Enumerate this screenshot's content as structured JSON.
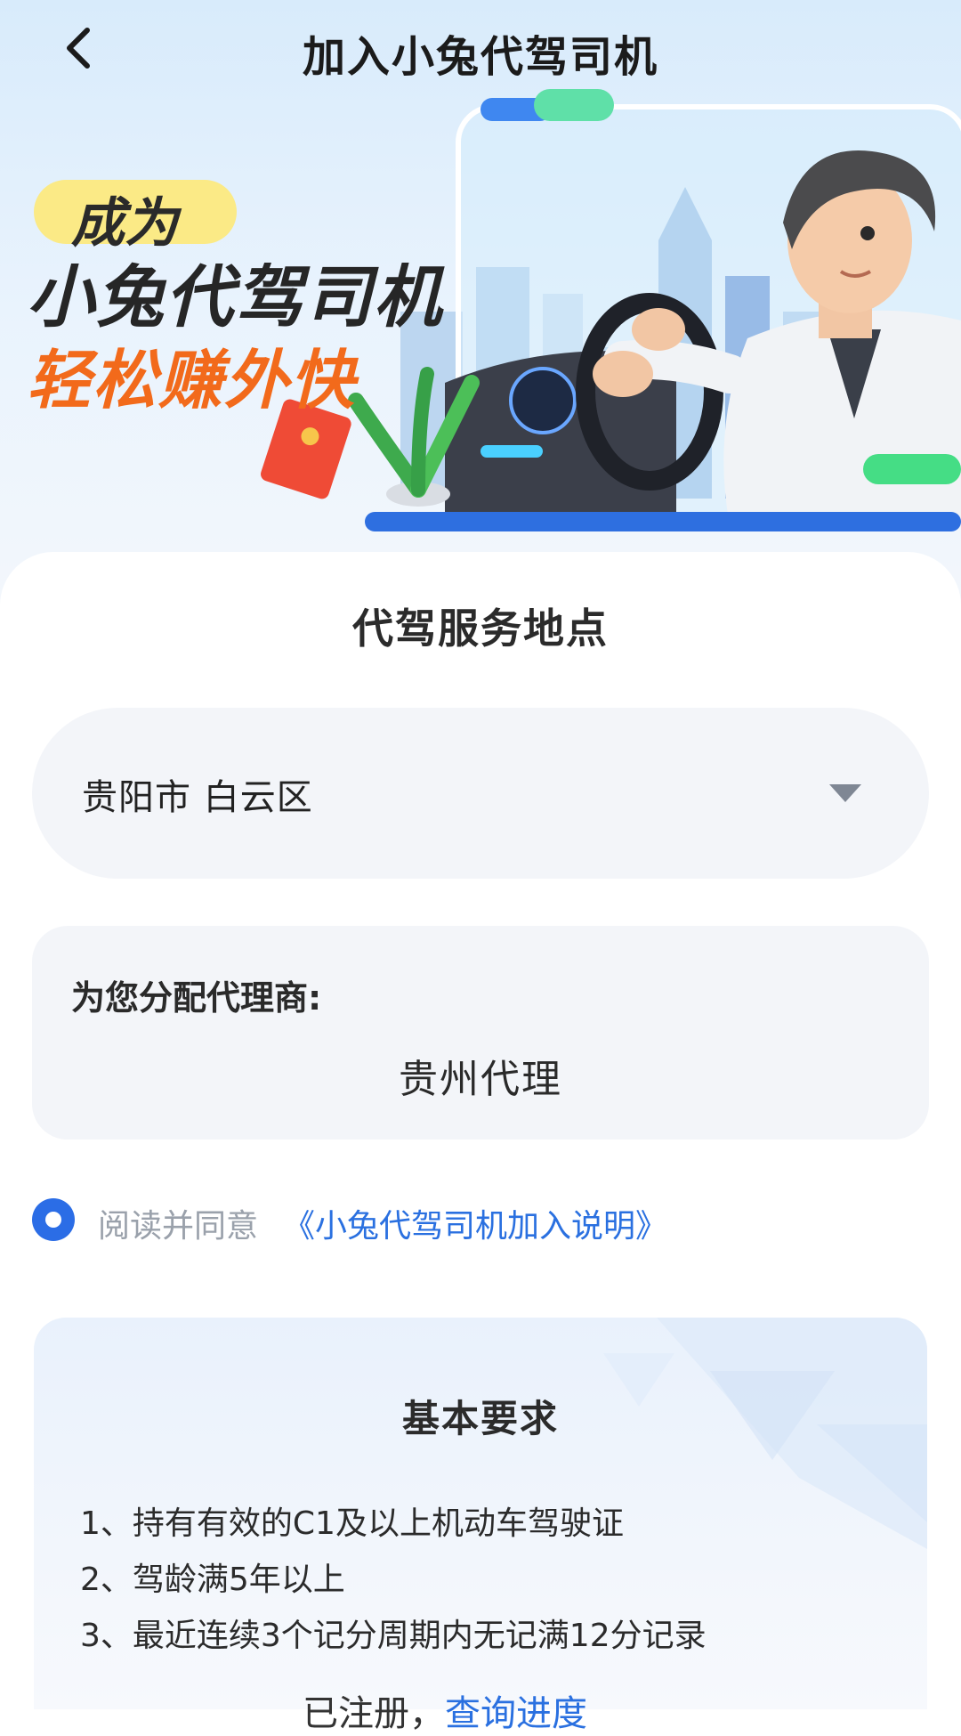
{
  "header": {
    "title": "加入小兔代驾司机",
    "back_icon": "chevron-left-icon"
  },
  "banner": {
    "slogan_line1": "成为",
    "slogan_line2": "小兔代驾司机",
    "slogan_line3": "轻松赚外快",
    "colors": {
      "accent_yellow": "#fbea86",
      "slogan_orange": "#f26a1b"
    }
  },
  "service_location": {
    "title": "代驾服务地点",
    "selected_city": "贵阳市 白云区",
    "dropdown_icon": "caret-down-icon"
  },
  "agent": {
    "label": "为您分配代理商:",
    "name": "贵州代理"
  },
  "agreement": {
    "checked": true,
    "text": "阅读并同意",
    "link": "《小兔代驾司机加入说明》"
  },
  "requirements": {
    "title": "基本要求",
    "items": [
      "1、持有有效的C1及以上机动车驾驶证",
      "2、驾龄满5年以上",
      "3、最近连续3个记分周期内无记满12分记录"
    ]
  },
  "bottom": {
    "partial_text": "已注册，",
    "partial_link": "查询进度"
  },
  "theme": {
    "primary": "#2b6de6",
    "link": "#2a70e0",
    "field_bg": "#f3f5f9"
  }
}
